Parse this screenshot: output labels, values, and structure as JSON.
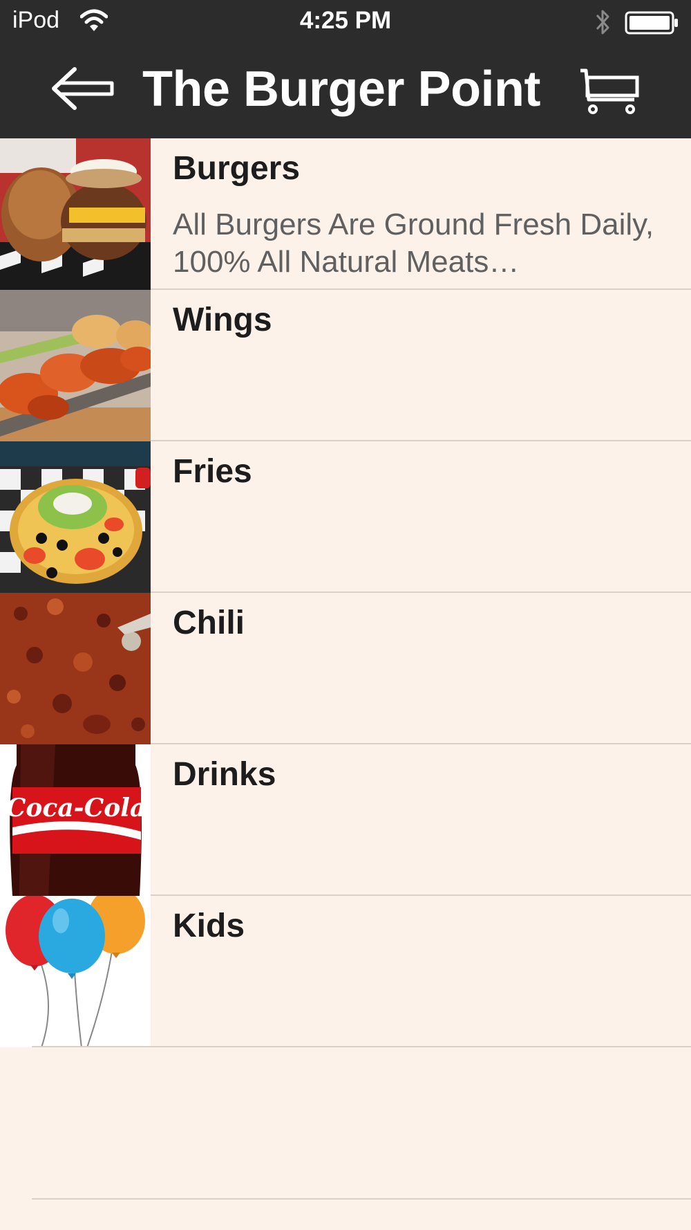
{
  "status_bar": {
    "carrier": "iPod",
    "time": "4:25 PM"
  },
  "nav": {
    "title": "The Burger Point"
  },
  "menu": {
    "items": [
      {
        "title": "Burgers",
        "description": "All Burgers Are Ground Fresh Daily, 100% All Natural Meats…"
      },
      {
        "title": "Wings"
      },
      {
        "title": "Fries"
      },
      {
        "title": "Chili"
      },
      {
        "title": "Drinks",
        "thumbnail_text": "Coca-Cola"
      },
      {
        "title": "Kids"
      }
    ]
  },
  "colors": {
    "bar_background": "#2c2c2c",
    "list_background": "#fdf2e9",
    "divider": "#d8d0ca"
  }
}
